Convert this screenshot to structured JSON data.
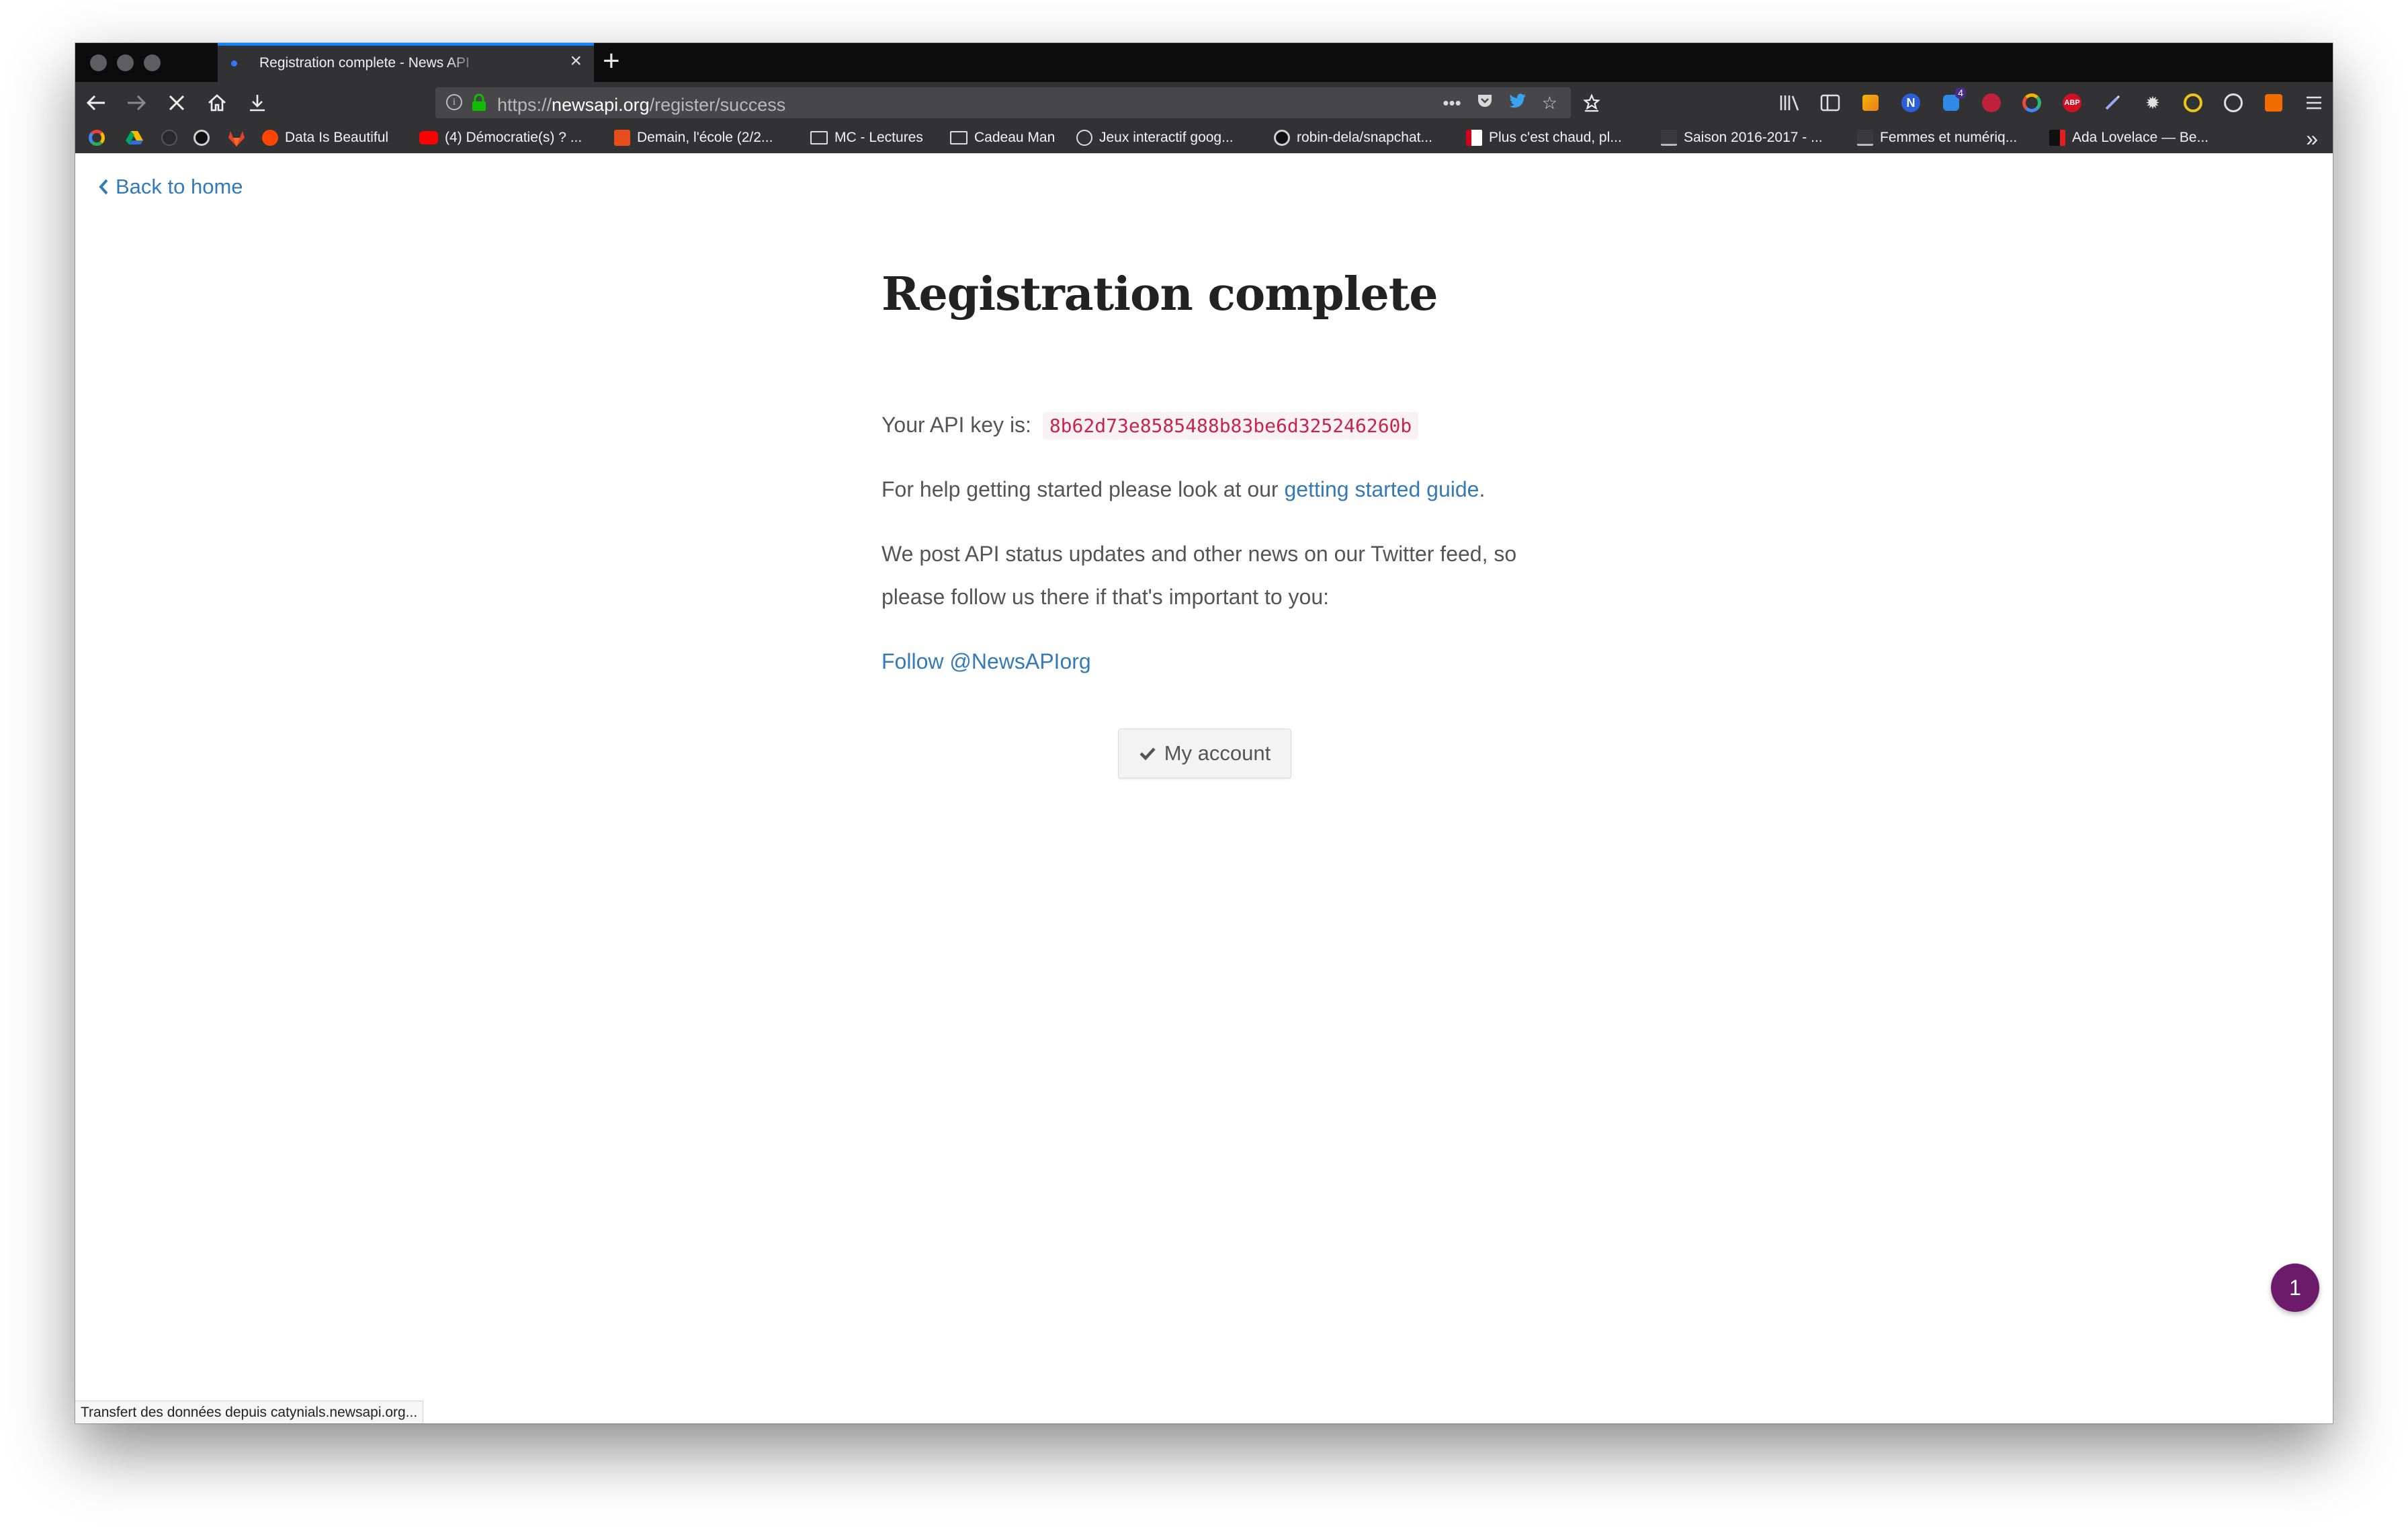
{
  "browser": {
    "tab": {
      "title": "Registration complete - News API"
    },
    "url": {
      "prefix": "https://",
      "host": "newsapi.org",
      "path": "/register/success"
    },
    "toolbar_badge": "4",
    "status": "Transfert des données depuis catynials.newsapi.org..."
  },
  "bookmarks": [
    {
      "label": "Data Is Beautiful",
      "icon": "reddit-icon",
      "color": "#ff4500"
    },
    {
      "label": "(4) Démocratie(s) ? ...",
      "icon": "youtube-icon",
      "color": "#ff0000"
    },
    {
      "label": "Demain, l'école (2/2...",
      "icon": "arte-icon",
      "color": "#e84e1b"
    },
    {
      "label": "MC - Lectures",
      "icon": "folder-icon"
    },
    {
      "label": "Cadeau Man",
      "icon": "folder-icon"
    },
    {
      "label": "Jeux interactif goog...",
      "icon": "globe-icon"
    },
    {
      "label": "robin-dela/snapchat...",
      "icon": "github-icon"
    },
    {
      "label": "Plus c'est chaud, pl...",
      "icon": "page-icon",
      "color": "#d0021b"
    },
    {
      "label": "Saison 2016-2017 - ...",
      "icon": "cite-icon"
    },
    {
      "label": "Femmes et numériq...",
      "icon": "cite-icon"
    },
    {
      "label": "Ada Lovelace — Be...",
      "icon": "bc-icon",
      "color": "#e02020"
    }
  ],
  "page": {
    "back_link": "Back to home",
    "title": "Registration complete",
    "api_key_label": "Your API key is:",
    "api_key": "8b62d73e8585488b83be6d325246260b",
    "help_prefix": "For help getting started please look at our",
    "help_link": "getting started guide",
    "help_suffix": ".",
    "twitter_line1": "We post API status updates and other news on our Twitter feed, so",
    "twitter_line2": "please follow us there if that's important to you:",
    "follow_link": "Follow @NewsAPIorg",
    "account_button": "My account",
    "chat_count": "1"
  },
  "colors": {
    "link": "#337ab7",
    "code": "#c7254e",
    "chat": "#6c1a6b",
    "chrome": "#323234"
  }
}
